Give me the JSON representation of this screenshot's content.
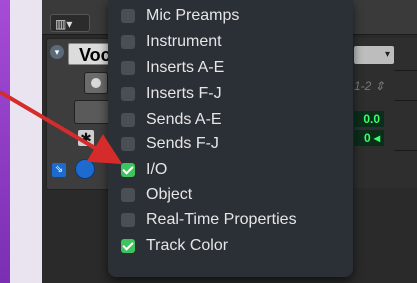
{
  "track": {
    "name": "Voc",
    "dropdown": "▾"
  },
  "right": {
    "io": "1-2",
    "vol": "0.0",
    "pan": "0"
  },
  "menu": {
    "items": [
      {
        "label": "Mic Preamps",
        "checked": false
      },
      {
        "label": "Instrument",
        "checked": false
      },
      {
        "label": "Inserts A-E",
        "checked": false
      },
      {
        "label": "Inserts F-J",
        "checked": false
      },
      {
        "label": "Sends A-E",
        "checked": false
      },
      {
        "label": "Sends F-J",
        "checked": false
      },
      {
        "label": "I/O",
        "checked": true
      },
      {
        "label": "Object",
        "checked": false
      },
      {
        "label": "Real-Time Properties",
        "checked": false
      },
      {
        "label": "Track Color",
        "checked": true
      }
    ]
  },
  "colors": {
    "accent_purple": "#a64bd6",
    "check_green": "#3ec45f",
    "annotation_arrow": "#d62b2b"
  }
}
